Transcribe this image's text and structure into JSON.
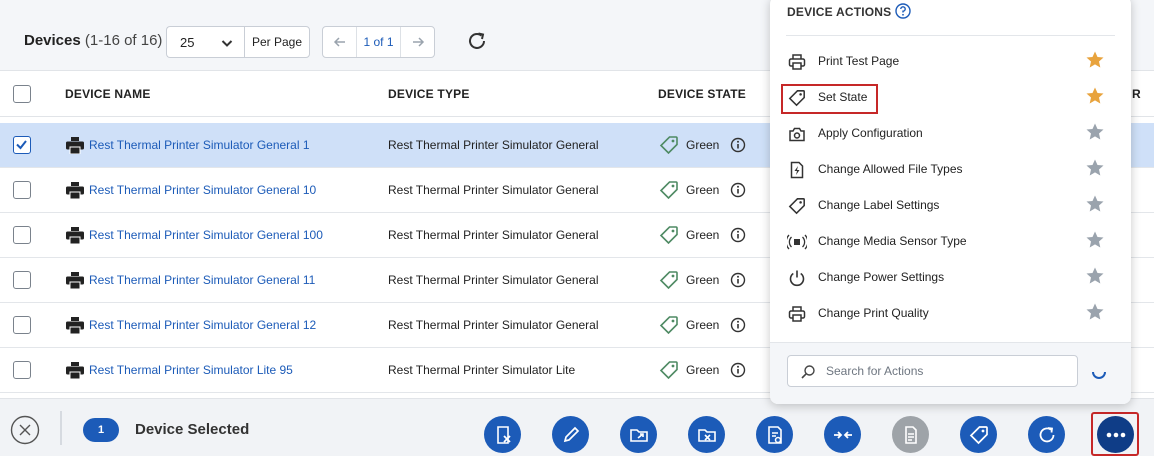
{
  "header": {
    "title": "Devices",
    "count_text": "(1-16 of 16)",
    "per_page_value": "25",
    "per_page_label": "Per Page",
    "page_text": "1 of 1"
  },
  "columns": {
    "name": "DEVICE NAME",
    "type": "DEVICE TYPE",
    "state": "DEVICE STATE",
    "extra_partial": "R"
  },
  "rows": [
    {
      "name": "Rest Thermal Printer Simulator General 1",
      "type": "Rest Thermal Printer Simulator General",
      "state": "Green",
      "selected": true
    },
    {
      "name": "Rest Thermal Printer Simulator General 10",
      "type": "Rest Thermal Printer Simulator General",
      "state": "Green",
      "selected": false
    },
    {
      "name": "Rest Thermal Printer Simulator General 100",
      "type": "Rest Thermal Printer Simulator General",
      "state": "Green",
      "selected": false
    },
    {
      "name": "Rest Thermal Printer Simulator General 11",
      "type": "Rest Thermal Printer Simulator General",
      "state": "Green",
      "selected": false
    },
    {
      "name": "Rest Thermal Printer Simulator General 12",
      "type": "Rest Thermal Printer Simulator General",
      "state": "Green",
      "selected": false
    },
    {
      "name": "Rest Thermal Printer Simulator Lite 95",
      "type": "Rest Thermal Printer Simulator Lite",
      "state": "Green",
      "selected": false
    }
  ],
  "actions_menu": {
    "title": "DEVICE ACTIONS",
    "items": [
      {
        "label": "Print Test Page",
        "icon": "printer-icon",
        "favorite": true
      },
      {
        "label": "Set State",
        "icon": "tag-icon",
        "favorite": true
      },
      {
        "label": "Apply Configuration",
        "icon": "config-icon",
        "favorite": false
      },
      {
        "label": "Change Allowed File Types",
        "icon": "file-bolt-icon",
        "favorite": false
      },
      {
        "label": "Change Label Settings",
        "icon": "tag-icon",
        "favorite": false
      },
      {
        "label": "Change Media Sensor Type",
        "icon": "sensor-icon",
        "favorite": false
      },
      {
        "label": "Change Power Settings",
        "icon": "power-icon",
        "favorite": false
      },
      {
        "label": "Change Print Quality",
        "icon": "printer-icon",
        "favorite": false
      }
    ],
    "search_placeholder": "Search for Actions"
  },
  "selection_bar": {
    "count": "1",
    "label": "Device Selected"
  },
  "colors": {
    "accent": "#1c5bb8",
    "star_active": "#e8a33d",
    "star_inactive": "#9aa3ad",
    "highlight": "#c62828",
    "state_tag": "#4e8a63"
  }
}
